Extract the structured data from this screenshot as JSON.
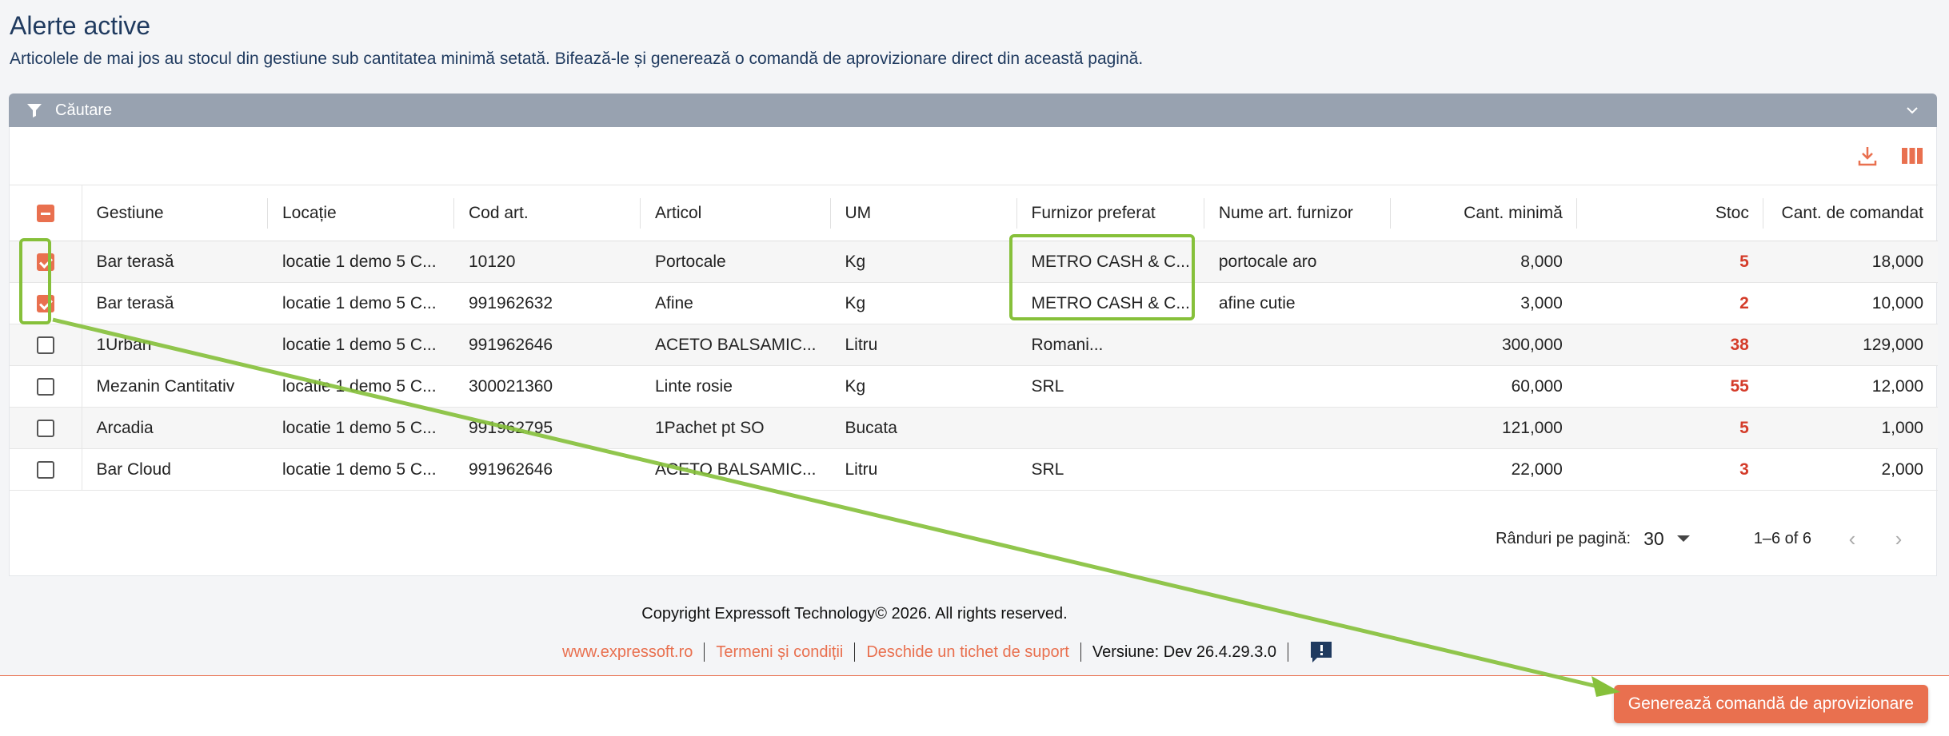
{
  "page": {
    "title": "Alerte active",
    "subtitle": "Articolele de mai jos au stocul din gestiune sub cantitatea minimă setată. Bifează-le și generează o comandă de aprovizionare direct din această pagină."
  },
  "search": {
    "label": "Căutare"
  },
  "toolbar": {
    "download_icon": "download-icon",
    "columns_icon": "columns-icon"
  },
  "table": {
    "headers": [
      "Gestiune",
      "Locație",
      "Cod art.",
      "Articol",
      "UM",
      "Furnizor preferat",
      "Nume art. furnizor",
      "Cant. minimă",
      "Stoc",
      "Cant. de comandat"
    ],
    "rows": [
      {
        "checked": true,
        "gestiune": "Bar terasă",
        "locatie": "locatie 1 demo 5 C...",
        "cod": "10120",
        "articol": "Portocale",
        "um": "Kg",
        "furnizor": "METRO CASH & C...",
        "nume_furnizor": "portocale aro",
        "cant_min": "8,000",
        "stoc": "5",
        "cant_comandat": "18,000"
      },
      {
        "checked": true,
        "gestiune": "Bar terasă",
        "locatie": "locatie 1 demo 5 C...",
        "cod": "991962632",
        "articol": "Afine",
        "um": "Kg",
        "furnizor": "METRO CASH & C...",
        "nume_furnizor": "afine cutie",
        "cant_min": "3,000",
        "stoc": "2",
        "cant_comandat": "10,000"
      },
      {
        "checked": false,
        "gestiune": "1Urban",
        "locatie": "locatie 1 demo 5 C...",
        "cod": "991962646",
        "articol": "ACETO BALSAMIC...",
        "um": "Litru",
        "furnizor": "Romani...",
        "nume_furnizor": "",
        "cant_min": "300,000",
        "stoc": "38",
        "cant_comandat": "129,000"
      },
      {
        "checked": false,
        "gestiune": "Mezanin Cantitativ",
        "locatie": "locatie 1 demo 5 C...",
        "cod": "300021360",
        "articol": "Linte rosie",
        "um": "Kg",
        "furnizor": "SRL",
        "nume_furnizor": "",
        "cant_min": "60,000",
        "stoc": "55",
        "cant_comandat": "12,000"
      },
      {
        "checked": false,
        "gestiune": "Arcadia",
        "locatie": "locatie 1 demo 5 C...",
        "cod": "991962795",
        "articol": "1Pachet pt SO",
        "um": "Bucata",
        "furnizor": "",
        "nume_furnizor": "",
        "cant_min": "121,000",
        "stoc": "5",
        "cant_comandat": "1,000"
      },
      {
        "checked": false,
        "gestiune": "Bar Cloud",
        "locatie": "locatie 1 demo 5 C...",
        "cod": "991962646",
        "articol": "ACETO BALSAMIC...",
        "um": "Litru",
        "furnizor": "SRL",
        "nume_furnizor": "",
        "cant_min": "22,000",
        "stoc": "3",
        "cant_comandat": "2,000"
      }
    ]
  },
  "pagination": {
    "rows_label": "Rânduri pe pagină:",
    "rows_value": "30",
    "range": "1–6 of 6"
  },
  "footer": {
    "copyright": "Copyright Expressoft Technology© 2026. All rights reserved.",
    "link_site": "www.expressoft.ro",
    "link_terms": "Termeni și condiții",
    "link_ticket": "Deschide un tichet de suport",
    "version": "Versiune: Dev 26.4.29.3.0"
  },
  "actions": {
    "generate_label": "Generează comandă de aprovizionare"
  },
  "colors": {
    "accent": "#e9704f",
    "stock_red": "#d43c2a",
    "annotation_green": "#86c03a",
    "header_bar": "#98a2b0",
    "title": "#1f3a5f"
  }
}
